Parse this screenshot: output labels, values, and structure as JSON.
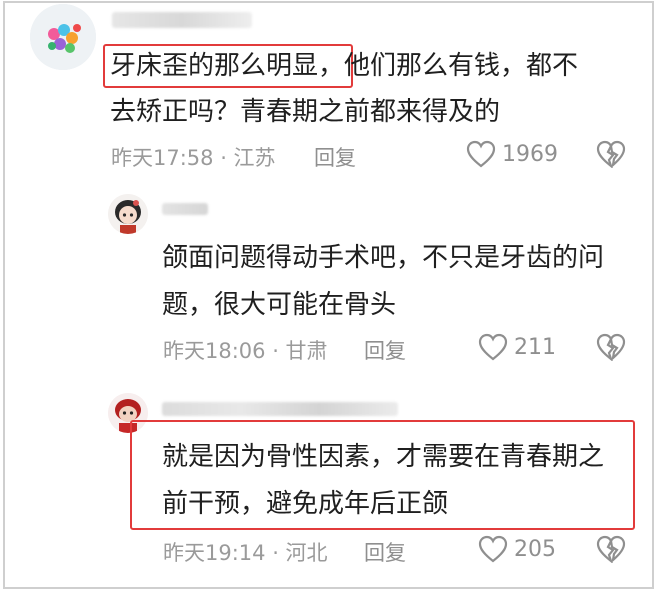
{
  "comments": [
    {
      "username": "\u0000",
      "highlight": "牙床歪的那么明显，",
      "text_line1_rest": "他们那么有钱，都不",
      "text_line2": "去矫正吗？青春期之前都来得及的",
      "time": "昨天17:58 · 江苏",
      "reply_label": "回复",
      "likes": "1969"
    },
    {
      "username": "\u0000",
      "text_line1": "颌面问题得动手术吧，不只是牙齿的问",
      "text_line2": "题，很大可能在骨头",
      "time": "昨天18:06 · 甘肃",
      "reply_label": "回复",
      "likes": "211"
    },
    {
      "username": "\u0000",
      "text_line1": "就是因为骨性因素，才需要在青春期之",
      "text_line2": "前干预，避免成年后正颌",
      "time": "昨天19:14 · 河北",
      "reply_label": "回复",
      "likes": "205"
    }
  ],
  "colors": {
    "highlight_border": "#e23b3b",
    "meta_text": "#9a9a9a"
  },
  "icons": {
    "like": "heart-outline-icon",
    "dislike": "broken-heart-icon"
  }
}
